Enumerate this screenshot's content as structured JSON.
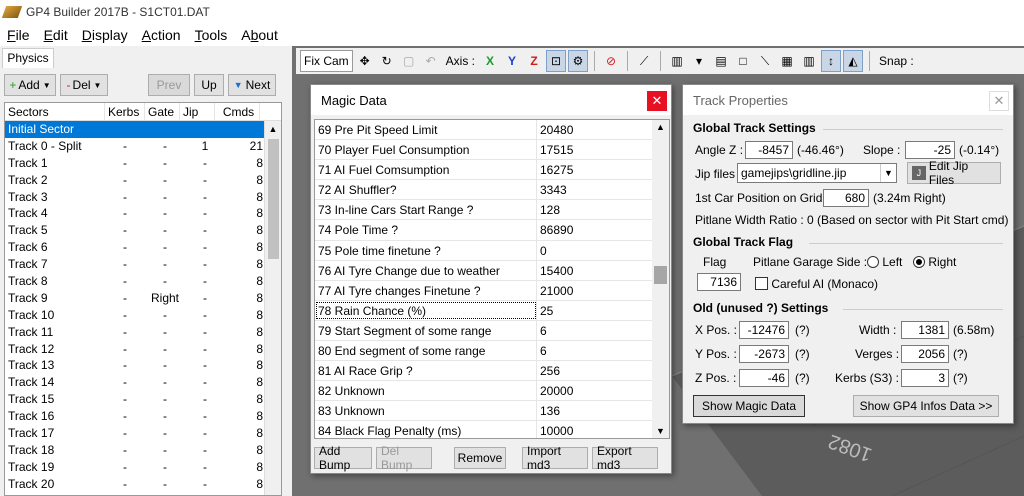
{
  "window": {
    "title": "GP4 Builder 2017B - S1CT01.DAT"
  },
  "menu": [
    {
      "accel": "F",
      "rest": "ile"
    },
    {
      "accel": "E",
      "rest": "dit"
    },
    {
      "accel": "D",
      "rest": "isplay"
    },
    {
      "accel": "A",
      "rest": "ction"
    },
    {
      "accel": "T",
      "rest": "ools"
    },
    {
      "accel": "",
      "rest": "About",
      "accel_index": 1
    }
  ],
  "left": {
    "tab": "Physics",
    "toolbar": {
      "add": "Add",
      "del": "Del",
      "prev": "Prev",
      "up": "Up",
      "next": "Next"
    },
    "columns": {
      "sectors": "Sectors",
      "kerbs": "Kerbs",
      "gate": "Gate",
      "jip": "Jip",
      "cmds": "Cmds"
    },
    "rows": [
      {
        "name": "Initial Sector",
        "kerbs": "",
        "gate": "",
        "jip": "",
        "cmds": "",
        "selected": true
      },
      {
        "name": "Track 0 - Split",
        "kerbs": "-",
        "gate": "-",
        "jip": "1",
        "cmds": "21"
      },
      {
        "name": "Track 1",
        "kerbs": "-",
        "gate": "-",
        "jip": "-",
        "cmds": "8"
      },
      {
        "name": "Track 2",
        "kerbs": "-",
        "gate": "-",
        "jip": "-",
        "cmds": "8"
      },
      {
        "name": "Track 3",
        "kerbs": "-",
        "gate": "-",
        "jip": "-",
        "cmds": "8"
      },
      {
        "name": "Track 4",
        "kerbs": "-",
        "gate": "-",
        "jip": "-",
        "cmds": "8"
      },
      {
        "name": "Track 5",
        "kerbs": "-",
        "gate": "-",
        "jip": "-",
        "cmds": "8"
      },
      {
        "name": "Track 6",
        "kerbs": "-",
        "gate": "-",
        "jip": "-",
        "cmds": "8"
      },
      {
        "name": "Track 7",
        "kerbs": "-",
        "gate": "-",
        "jip": "-",
        "cmds": "8"
      },
      {
        "name": "Track 8",
        "kerbs": "-",
        "gate": "-",
        "jip": "-",
        "cmds": "8"
      },
      {
        "name": "Track 9",
        "kerbs": "-",
        "gate": "Right",
        "jip": "-",
        "cmds": "8"
      },
      {
        "name": "Track 10",
        "kerbs": "-",
        "gate": "-",
        "jip": "-",
        "cmds": "8"
      },
      {
        "name": "Track 11",
        "kerbs": "-",
        "gate": "-",
        "jip": "-",
        "cmds": "8"
      },
      {
        "name": "Track 12",
        "kerbs": "-",
        "gate": "-",
        "jip": "-",
        "cmds": "8"
      },
      {
        "name": "Track 13",
        "kerbs": "-",
        "gate": "-",
        "jip": "-",
        "cmds": "8"
      },
      {
        "name": "Track 14",
        "kerbs": "-",
        "gate": "-",
        "jip": "-",
        "cmds": "8"
      },
      {
        "name": "Track 15",
        "kerbs": "-",
        "gate": "-",
        "jip": "-",
        "cmds": "8"
      },
      {
        "name": "Track 16",
        "kerbs": "-",
        "gate": "-",
        "jip": "-",
        "cmds": "8"
      },
      {
        "name": "Track 17",
        "kerbs": "-",
        "gate": "-",
        "jip": "-",
        "cmds": "8"
      },
      {
        "name": "Track 18",
        "kerbs": "-",
        "gate": "-",
        "jip": "-",
        "cmds": "8"
      },
      {
        "name": "Track 19",
        "kerbs": "-",
        "gate": "-",
        "jip": "-",
        "cmds": "8"
      },
      {
        "name": "Track 20",
        "kerbs": "-",
        "gate": "-",
        "jip": "-",
        "cmds": "8"
      }
    ]
  },
  "viewport_toolbar": {
    "fixcam": "Fix Cam",
    "axis": "Axis :",
    "x": "X",
    "y": "Y",
    "z": "Z",
    "snap": "Snap :"
  },
  "magic": {
    "title": "Magic Data",
    "rows": [
      {
        "name": "69 Pre Pit Speed Limit",
        "value": "20480"
      },
      {
        "name": "70 Player Fuel Consumption",
        "value": "17515"
      },
      {
        "name": "71 AI Fuel Comsumption",
        "value": "16275"
      },
      {
        "name": "72 AI Shuffler?",
        "value": "3343"
      },
      {
        "name": "73 In-line Cars Start Range ?",
        "value": "128"
      },
      {
        "name": "74 Pole Time ?",
        "value": "86890"
      },
      {
        "name": "75 Pole time finetune ?",
        "value": "0"
      },
      {
        "name": "76 AI Tyre Change due to weather",
        "value": "15400"
      },
      {
        "name": "77 AI Tyre changes Finetune ?",
        "value": "21000"
      },
      {
        "name": "78 Rain Chance (%)",
        "value": "25",
        "focused": true
      },
      {
        "name": "79 Start Segment of some range",
        "value": "6"
      },
      {
        "name": "80 End segment of some range",
        "value": "6"
      },
      {
        "name": "81 AI Race Grip ?",
        "value": "256"
      },
      {
        "name": "82 Unknown",
        "value": "20000"
      },
      {
        "name": "83 Unknown",
        "value": "136"
      },
      {
        "name": "84 Black Flag Penalty (ms)",
        "value": "10000"
      }
    ],
    "buttons": {
      "add_bump": "Add Bump",
      "del_bump": "Del Bump",
      "remove": "Remove",
      "import": "Import md3",
      "export": "Export md3"
    }
  },
  "track": {
    "title": "Track Properties",
    "global_settings": "Global Track Settings",
    "angle_label": "Angle Z :",
    "angle_value": "-8457",
    "angle_deg": "(-46.46°)",
    "slope_label": "Slope :",
    "slope_value": "-25",
    "slope_deg": "(-0.14°)",
    "jip_label": "Jip files :",
    "jip_value": "gamejips\\gridline.jip",
    "edit_jip": "Edit Jip Files",
    "first_car_label": "1st Car Position on Grid :",
    "first_car_value": "680",
    "first_car_m": "(3.24m Right)",
    "pitlane_ratio": "Pitlane Width Ratio : 0 (Based on sector with Pit Start cmd)",
    "global_flag": "Global Track Flag",
    "flag_label": "Flag",
    "flag_value": "7136",
    "garage_label": "Pitlane Garage Side :",
    "garage_left": "Left",
    "garage_right": "Right",
    "careful_ai": "Careful AI (Monaco)",
    "old_settings": "Old (unused ?) Settings",
    "xpos_label": "X Pos. :",
    "xpos_value": "-12476",
    "xpos_unit": "(?)",
    "ypos_label": "Y Pos. :",
    "ypos_value": "-2673",
    "ypos_unit": "(?)",
    "zpos_label": "Z Pos. :",
    "zpos_value": "-46",
    "zpos_unit": "(?)",
    "width_label": "Width :",
    "width_value": "1381",
    "width_unit": "(6.58m)",
    "verges_label": "Verges :",
    "verges_value": "2056",
    "verges_unit": "(?)",
    "kerbs_label": "Kerbs (S3) :",
    "kerbs_value": "3",
    "kerbs_unit": "(?)",
    "show_magic": "Show Magic Data",
    "show_gp4": "Show GP4 Infos Data >>"
  },
  "viewport_label": "1082"
}
